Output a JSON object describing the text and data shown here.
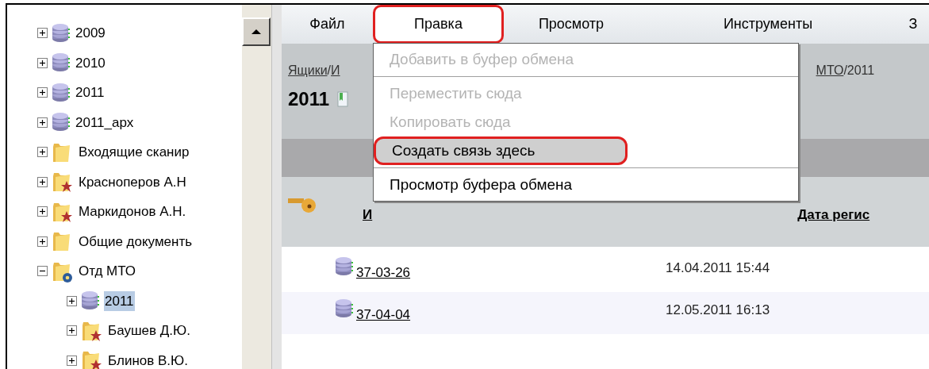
{
  "tree": {
    "items": [
      {
        "label": "2009",
        "kind": "database",
        "expanded": false,
        "selected": false
      },
      {
        "label": "2010",
        "kind": "database",
        "expanded": false,
        "selected": false
      },
      {
        "label": "2011",
        "kind": "database",
        "expanded": false,
        "selected": false
      },
      {
        "label": "2011_арх",
        "kind": "database",
        "expanded": false,
        "selected": false
      },
      {
        "label": "Входящие сканир",
        "kind": "folder",
        "expanded": false,
        "selected": false
      },
      {
        "label": "Красноперов А.Н",
        "kind": "folder_star",
        "expanded": false,
        "selected": false
      },
      {
        "label": "Маркидонов А.Н.",
        "kind": "folder_star",
        "expanded": false,
        "selected": false
      },
      {
        "label": "Общие документь",
        "kind": "folder",
        "expanded": false,
        "selected": false
      },
      {
        "label": "Отд МТО",
        "kind": "folder_gear",
        "expanded": true,
        "selected": false,
        "children": [
          {
            "label": "2011",
            "kind": "database",
            "expanded": false,
            "selected": true
          },
          {
            "label": "Баушев Д.Ю.",
            "kind": "folder_star",
            "expanded": false,
            "selected": false
          },
          {
            "label": "Блинов В.Ю.",
            "kind": "folder_star",
            "expanded": false,
            "selected": false
          }
        ]
      }
    ]
  },
  "menu_bar": [
    {
      "label": "Файл",
      "selected": false
    },
    {
      "label": "Правка",
      "selected": true
    },
    {
      "label": "Просмотр",
      "selected": false
    },
    {
      "label": "Инструменты",
      "selected": false
    },
    {
      "label": "З",
      "selected": false
    }
  ],
  "dropdown": [
    {
      "kind": "item",
      "label": "Добавить в буфер обмена",
      "disabled": true,
      "highlighted": false
    },
    {
      "kind": "separator"
    },
    {
      "kind": "item",
      "label": "Переместить сюда",
      "disabled": true,
      "highlighted": false
    },
    {
      "kind": "item",
      "label": "Копировать сюда",
      "disabled": true,
      "highlighted": false
    },
    {
      "kind": "item",
      "label": "Создать связь здесь",
      "disabled": false,
      "highlighted": true
    },
    {
      "kind": "separator"
    },
    {
      "kind": "item",
      "label": "Просмотр буфера обмена",
      "disabled": false,
      "highlighted": false
    }
  ],
  "breadcrumb": {
    "left": [
      {
        "text": "Ящики",
        "kind": "link"
      },
      {
        "text": "/",
        "kind": "separator"
      },
      {
        "text": "И",
        "kind": "link"
      }
    ],
    "right": [
      {
        "text": "МТО",
        "kind": "link"
      },
      {
        "text": "/2011",
        "kind": "current"
      }
    ]
  },
  "title": "2011",
  "table": {
    "columns": [
      "И",
      "Дата регис"
    ],
    "rows": [
      {
        "number": "37-03-26",
        "date": "14.04.2011 15:44"
      },
      {
        "number": "37-04-04",
        "date": "12.05.2011 16:13"
      }
    ]
  }
}
